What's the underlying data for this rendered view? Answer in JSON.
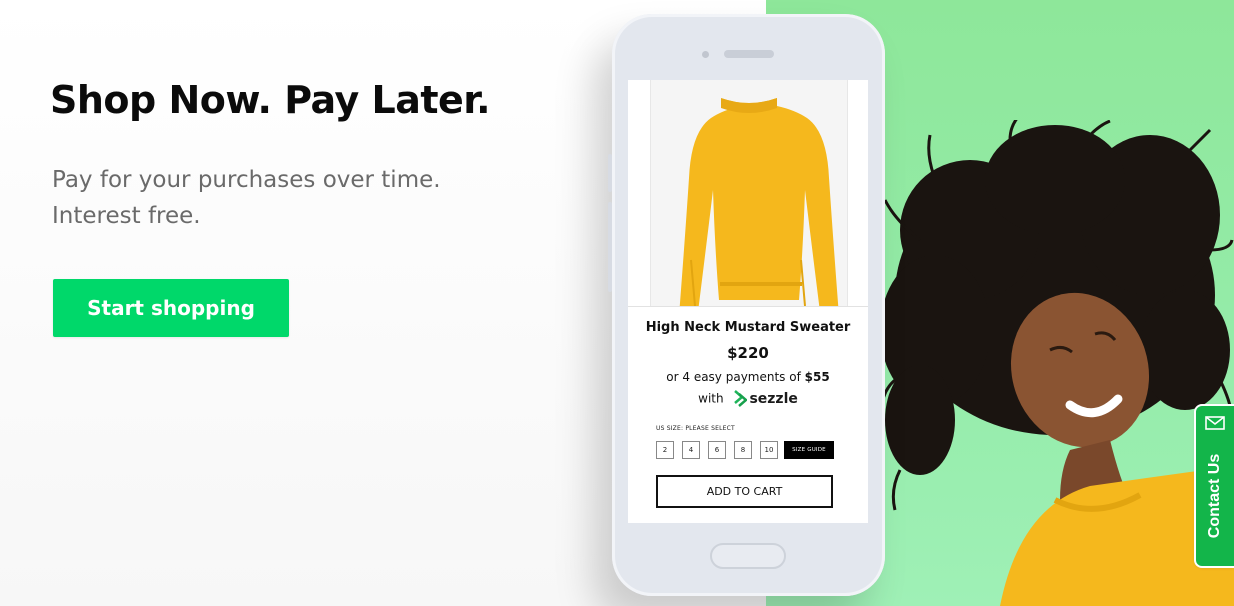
{
  "hero": {
    "title": "Shop Now. Pay Later.",
    "subtitle_line1": "Pay for your purchases over time.",
    "subtitle_line2": "Interest free.",
    "cta_label": "Start shopping"
  },
  "product": {
    "name": "High Neck Mustard Sweater",
    "price": "$220",
    "installment_prefix": "or 4 easy payments of",
    "installment_amount": "$55",
    "with_label": "with",
    "brand_name": "sezzle",
    "size_prompt": "US SIZE: PLEASE SELECT",
    "sizes": [
      "2",
      "4",
      "6",
      "8",
      "10"
    ],
    "size_guide_label": "SIZE GUIDE",
    "add_to_cart_label": "ADD TO CART"
  },
  "contact": {
    "label": "Contact Us",
    "icon": "envelope-icon"
  },
  "colors": {
    "cta_green": "#00d86a",
    "panel_green": "#8ee79a",
    "contact_green": "#13b54a",
    "mustard": "#f5b81d"
  }
}
